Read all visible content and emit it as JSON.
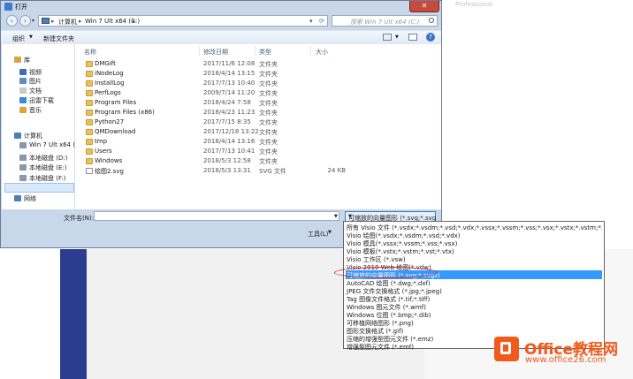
{
  "background": {
    "watermark_text": "Professional"
  },
  "window": {
    "title": "打开",
    "close_glyph": "✕"
  },
  "address": {
    "segments": [
      "计算机",
      "Win 7 Ult x64 (C:)"
    ],
    "search_placeholder": "搜索 Win 7 Ult x64 (C:)"
  },
  "toolbar": {
    "organize_label": "组织",
    "new_folder_label": "新建文件夹"
  },
  "navpane": {
    "items": [
      {
        "label": "库",
        "icon": "library-icon",
        "color": "#d8a640"
      },
      {
        "label": "视频",
        "icon": "video-icon",
        "color": "#3f6fb0"
      },
      {
        "label": "图片",
        "icon": "pictures-icon",
        "color": "#5b8fc9"
      },
      {
        "label": "文档",
        "icon": "documents-icon",
        "color": "#c9c9c9"
      },
      {
        "label": "迅雷下载",
        "icon": "download-icon",
        "color": "#3e8ad6"
      },
      {
        "label": "音乐",
        "icon": "music-icon",
        "color": "#e0a43a"
      },
      {
        "label": "计算机",
        "icon": "computer-icon",
        "color": "#4c7fb6"
      },
      {
        "label": "Win 7 Ult x64 (",
        "icon": "drive-icon",
        "color": "#8a98ad"
      },
      {
        "label": "本地磁盘 (D:)",
        "icon": "drive-icon",
        "color": "#8a98ad"
      },
      {
        "label": "本地磁盘 (E:)",
        "icon": "drive-icon",
        "color": "#8a98ad"
      },
      {
        "label": "本地磁盘 (F:)",
        "icon": "drive-icon",
        "color": "#8a98ad"
      },
      {
        "label": "网络",
        "icon": "network-icon",
        "color": "#4c7fb6"
      }
    ]
  },
  "filelist": {
    "headers": [
      "名称",
      "修改日期",
      "类型",
      "大小"
    ],
    "rows": [
      {
        "name": "DMGift",
        "date": "2017/11/6 12:08",
        "type": "文件夹",
        "size": "",
        "icon": "folder-icon"
      },
      {
        "name": "iNodeLog",
        "date": "2018/4/14 13:15",
        "type": "文件夹",
        "size": "",
        "icon": "folder-icon"
      },
      {
        "name": "InstallLog",
        "date": "2017/7/13 10:40",
        "type": "文件夹",
        "size": "",
        "icon": "folder-icon"
      },
      {
        "name": "PerfLogs",
        "date": "2009/7/14 11:20",
        "type": "文件夹",
        "size": "",
        "icon": "folder-icon"
      },
      {
        "name": "Program Files",
        "date": "2018/4/24 7:58",
        "type": "文件夹",
        "size": "",
        "icon": "folder-icon"
      },
      {
        "name": "Program Files (x86)",
        "date": "2018/4/23 11:23",
        "type": "文件夹",
        "size": "",
        "icon": "folder-icon"
      },
      {
        "name": "Python27",
        "date": "2017/7/15 8:35",
        "type": "文件夹",
        "size": "",
        "icon": "folder-icon"
      },
      {
        "name": "QMDownload",
        "date": "2017/12/18 13:22",
        "type": "文件夹",
        "size": "",
        "icon": "folder-icon"
      },
      {
        "name": "tmp",
        "date": "2018/4/14 13:16",
        "type": "文件夹",
        "size": "",
        "icon": "folder-icon"
      },
      {
        "name": "Users",
        "date": "2017/7/13 10:41",
        "type": "文件夹",
        "size": "",
        "icon": "folder-icon"
      },
      {
        "name": "Windows",
        "date": "2018/5/3 12:58",
        "type": "文件夹",
        "size": "",
        "icon": "folder-icon"
      },
      {
        "name": "绘图2.svg",
        "date": "2018/5/3 13:31",
        "type": "SVG 文件",
        "size": "24 KB",
        "icon": "svg-file-icon"
      }
    ]
  },
  "bottom": {
    "filename_label": "文件名(N):",
    "filename_value": "",
    "filetype_selected": "可缩放的向量图形 (*.svg;*.svg",
    "tools_label": "工具(L)"
  },
  "filetype_options": [
    "所有 Visio 文件 (*.vsdx;*.vsdm;*.vsd;*.vdx;*.vssx;*.vssm;*.vss;*.vsx;*.vstx;*.vstm;*.vst;*.vtx;*.vsw;*.vdw)",
    "Visio 绘图(*.vsdx;*.vsdm;*.vsd;*.vdx)",
    "Visio 模具(*.vssx;*.vssm;*.vss;*.vsx)",
    "Visio 模板(*.vstx;*.vstm;*.vst;*.vtx)",
    "Visio 工作区 (*.vsw)",
    "Visio 2010 Web 绘图(*.vdw)",
    "可缩放的向量图形 (*.svg;*.svgz)",
    "AutoCAD 绘图 (*.dwg;*.dxf)",
    "JPEG 文件交换格式 (*.jpg;*.jpeg)",
    "Tag 图像文件格式 (*.tif;*.tiff)",
    "Windows 图元文件 (*.wmf)",
    "Windows 位图 (*.bmp;*.dib)",
    "可移植网络图形 (*.png)",
    "图形交换格式 (*.gif)",
    "压缩的增强型图元文件 (*.emz)",
    "增强型图元文件 (*.emf)"
  ],
  "selected_option_index": 6,
  "logo": {
    "name": "Office教程网",
    "url": "www.office26.com",
    "color": "#f05a1a"
  }
}
